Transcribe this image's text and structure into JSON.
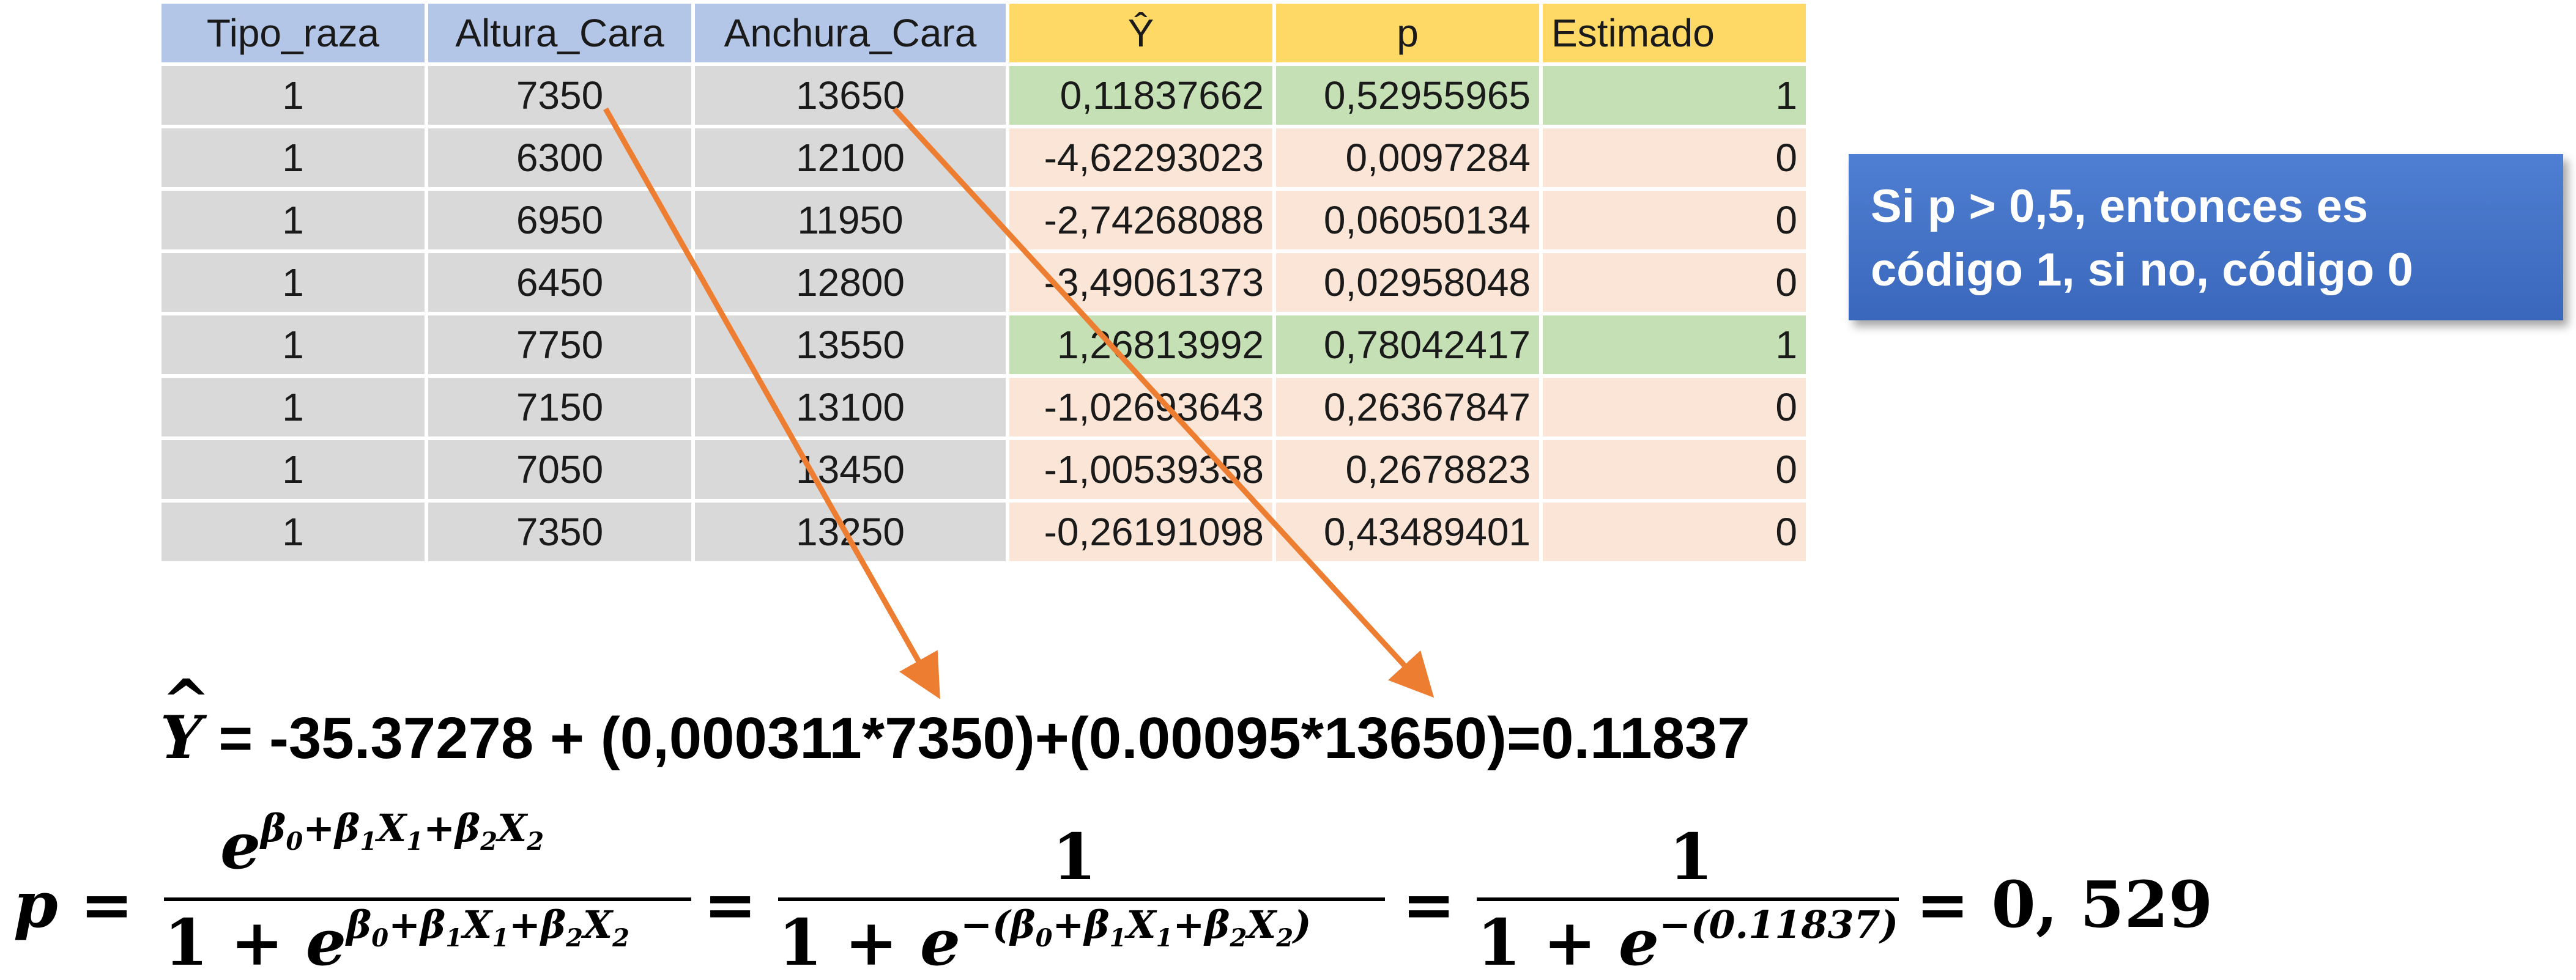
{
  "table": {
    "headers": [
      "Tipo_raza",
      "Altura_Cara",
      "Anchura_Cara",
      "Ŷ",
      "p",
      "Estimado"
    ],
    "rows": [
      {
        "tipo": "1",
        "altura": "7350",
        "anchura": "13650",
        "yhat": "0,11837662",
        "p": "0,52955965",
        "estimado": "1",
        "status": "green"
      },
      {
        "tipo": "1",
        "altura": "6300",
        "anchura": "12100",
        "yhat": "-4,62293023",
        "p": "0,0097284",
        "estimado": "0",
        "status": "pink"
      },
      {
        "tipo": "1",
        "altura": "6950",
        "anchura": "11950",
        "yhat": "-2,74268088",
        "p": "0,06050134",
        "estimado": "0",
        "status": "pink"
      },
      {
        "tipo": "1",
        "altura": "6450",
        "anchura": "12800",
        "yhat": "-3,49061373",
        "p": "0,02958048",
        "estimado": "0",
        "status": "pink"
      },
      {
        "tipo": "1",
        "altura": "7750",
        "anchura": "13550",
        "yhat": "1,26813992",
        "p": "0,78042417",
        "estimado": "1",
        "status": "green"
      },
      {
        "tipo": "1",
        "altura": "7150",
        "anchura": "13100",
        "yhat": "-1,02693643",
        "p": "0,26367847",
        "estimado": "0",
        "status": "pink"
      },
      {
        "tipo": "1",
        "altura": "7050",
        "anchura": "13450",
        "yhat": "-1,00539358",
        "p": "0,2678823",
        "estimado": "0",
        "status": "pink"
      },
      {
        "tipo": "1",
        "altura": "7350",
        "anchura": "13250",
        "yhat": "-0,26191098",
        "p": "0,43489401",
        "estimado": "0",
        "status": "pink"
      }
    ]
  },
  "callout": {
    "line1": "Si p > 0,5, entonces es",
    "line2": "código 1, si no, código 0"
  },
  "equation_yhat": {
    "symbol": "Y",
    "hat": "^",
    "expression": " = -35.37278 + (0,000311*7350)+(0.00095*13650)=0.11837"
  },
  "equation_p": {
    "lhs": "p =",
    "frac1_num": "e^(β0+β1X1+β2X2)",
    "frac1_den": "1 + e^(β0+β1X1+β2X2)",
    "eq1": "=",
    "frac2_num": "1",
    "frac2_den": "1 + e^−(β0+β1X1+β2X2)",
    "eq2": "=",
    "frac3_num": "1",
    "frac3_den": "1 + e^−(0.11837)",
    "result": "= 0, 529"
  },
  "colors": {
    "header_blue": "#b4c6e7",
    "header_yellow": "#ffd966",
    "cell_gray": "#d9d9d9",
    "cell_green": "#c5e0b4",
    "cell_pink": "#fbe5d6",
    "arrow_orange": "#ed7d31",
    "callout_blue": "#4472c4"
  }
}
